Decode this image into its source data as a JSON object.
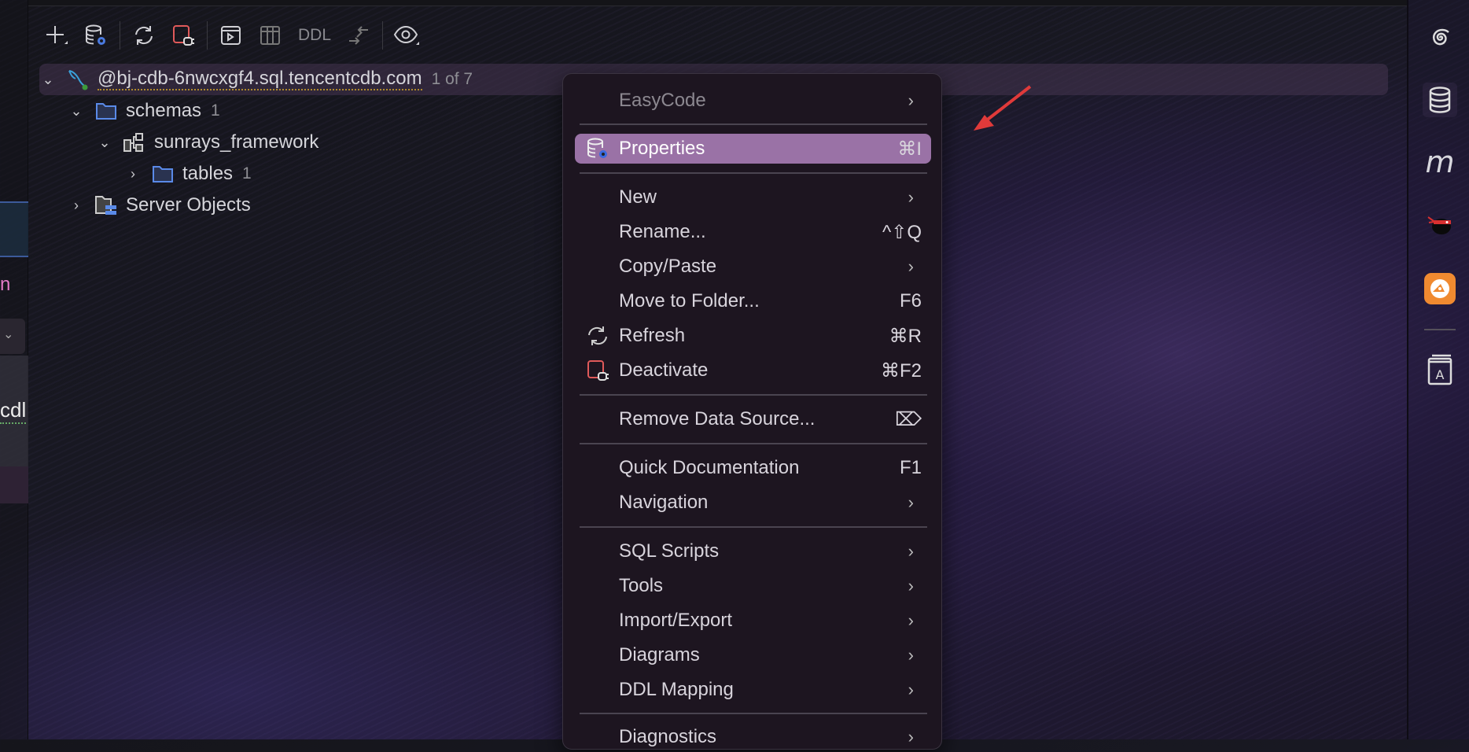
{
  "toolbar": {
    "items": [
      {
        "icon": "plus-icon",
        "label": "New"
      },
      {
        "icon": "database-settings-icon",
        "label": "Data Source Properties"
      },
      {
        "icon": "refresh-icon",
        "label": "Refresh"
      },
      {
        "icon": "deactivate-icon",
        "label": "Deactivate"
      },
      {
        "icon": "console-icon",
        "label": "Jump to Query Console"
      },
      {
        "icon": "table-icon",
        "label": "Edit Data"
      },
      {
        "icon": "ddl-icon",
        "label": "DDL"
      },
      {
        "icon": "compare-icon",
        "label": "Compare"
      },
      {
        "icon": "eye-icon",
        "label": "View Options"
      }
    ],
    "ddl_label": "DDL"
  },
  "tree": {
    "datasource": {
      "name": "@bj-cdb-6nwcxgf4.sql.tencentcdb.com",
      "count": "1 of 7"
    },
    "schemas": {
      "name": "schemas",
      "count": "1"
    },
    "schema": {
      "name": "sunrays_framework"
    },
    "tables": {
      "name": "tables",
      "count": "1"
    },
    "server_objects": {
      "name": "Server Objects"
    }
  },
  "left_panel": {
    "fragment1": "n",
    "fragment2": "cdl"
  },
  "context_menu": {
    "items": [
      {
        "label": "EasyCode",
        "submenu": true,
        "disabled": true
      },
      {
        "label": "Properties",
        "shortcut": "⌘I",
        "highlighted": true
      },
      {
        "label": "New",
        "submenu": true
      },
      {
        "label": "Rename...",
        "shortcut": "^⇧Q"
      },
      {
        "label": "Copy/Paste",
        "submenu": true
      },
      {
        "label": "Move to Folder...",
        "shortcut": "F6"
      },
      {
        "label": "Refresh",
        "shortcut": "⌘R"
      },
      {
        "label": "Deactivate",
        "shortcut": "⌘F2"
      },
      {
        "label": "Remove Data Source...",
        "shortcut": "⌦"
      },
      {
        "label": "Quick Documentation",
        "shortcut": "F1"
      },
      {
        "label": "Navigation",
        "submenu": true
      },
      {
        "label": "SQL Scripts",
        "submenu": true
      },
      {
        "label": "Tools",
        "submenu": true
      },
      {
        "label": "Import/Export",
        "submenu": true
      },
      {
        "label": "Diagrams",
        "submenu": true
      },
      {
        "label": "DDL Mapping",
        "submenu": true
      },
      {
        "label": "Diagnostics",
        "submenu": true
      }
    ],
    "chevron": "›",
    "highlight_color": "#9a72a6"
  },
  "right_sidebar": {
    "icons": [
      "spiral-icon",
      "database-icon",
      "m-icon",
      "ninja-icon",
      "orange-app-icon",
      "dictionary-icon"
    ],
    "m_label": "m",
    "dict_label": "A"
  },
  "annotation": {
    "arrow_color": "#e03a3a"
  }
}
